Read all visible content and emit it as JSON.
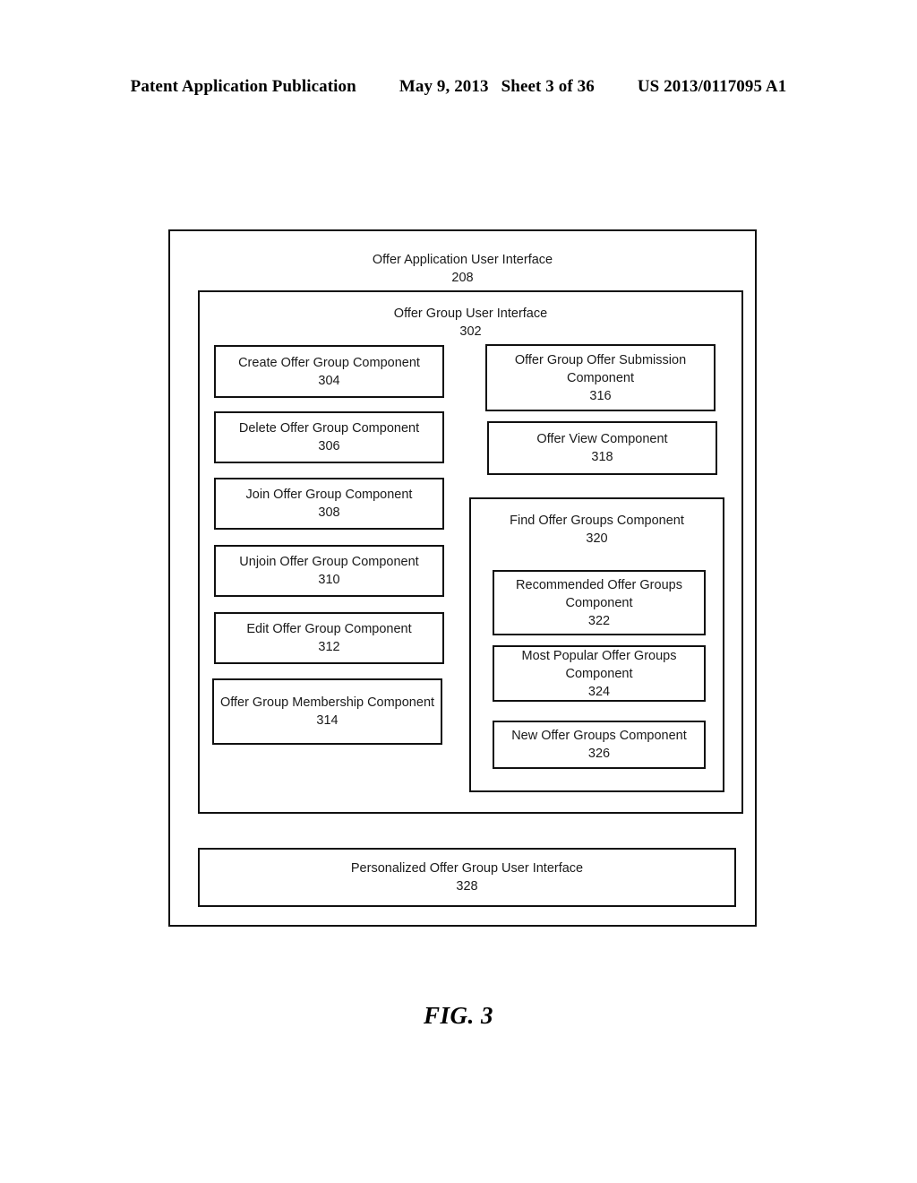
{
  "header": {
    "publication": "Patent Application Publication",
    "date": "May 9, 2013",
    "sheet": "Sheet 3 of 36",
    "document_number": "US 2013/0117095 A1"
  },
  "figure": {
    "caption": "FIG. 3",
    "outer": {
      "title": "Offer Application User Interface",
      "ref": "208"
    },
    "offer_group_ui": {
      "title": "Offer Group User Interface",
      "ref": "302",
      "left_column": [
        {
          "title": "Create Offer Group Component",
          "ref": "304"
        },
        {
          "title": "Delete Offer Group Component",
          "ref": "306"
        },
        {
          "title": "Join Offer Group Component",
          "ref": "308"
        },
        {
          "title": "Unjoin Offer Group Component",
          "ref": "310"
        },
        {
          "title": "Edit Offer Group Component",
          "ref": "312"
        },
        {
          "title": "Offer Group Membership Component",
          "ref": "314"
        }
      ],
      "right_column": [
        {
          "title": "Offer Group Offer Submission Component",
          "ref": "316"
        },
        {
          "title": "Offer View Component",
          "ref": "318"
        }
      ],
      "find_offer_groups": {
        "title": "Find Offer Groups Component",
        "ref": "320",
        "children": [
          {
            "title": "Recommended Offer Groups Component",
            "ref": "322"
          },
          {
            "title": "Most Popular Offer Groups Component",
            "ref": "324"
          },
          {
            "title": "New Offer Groups Component",
            "ref": "326"
          }
        ]
      }
    },
    "personalized": {
      "title": "Personalized Offer Group User Interface",
      "ref": "328"
    }
  }
}
